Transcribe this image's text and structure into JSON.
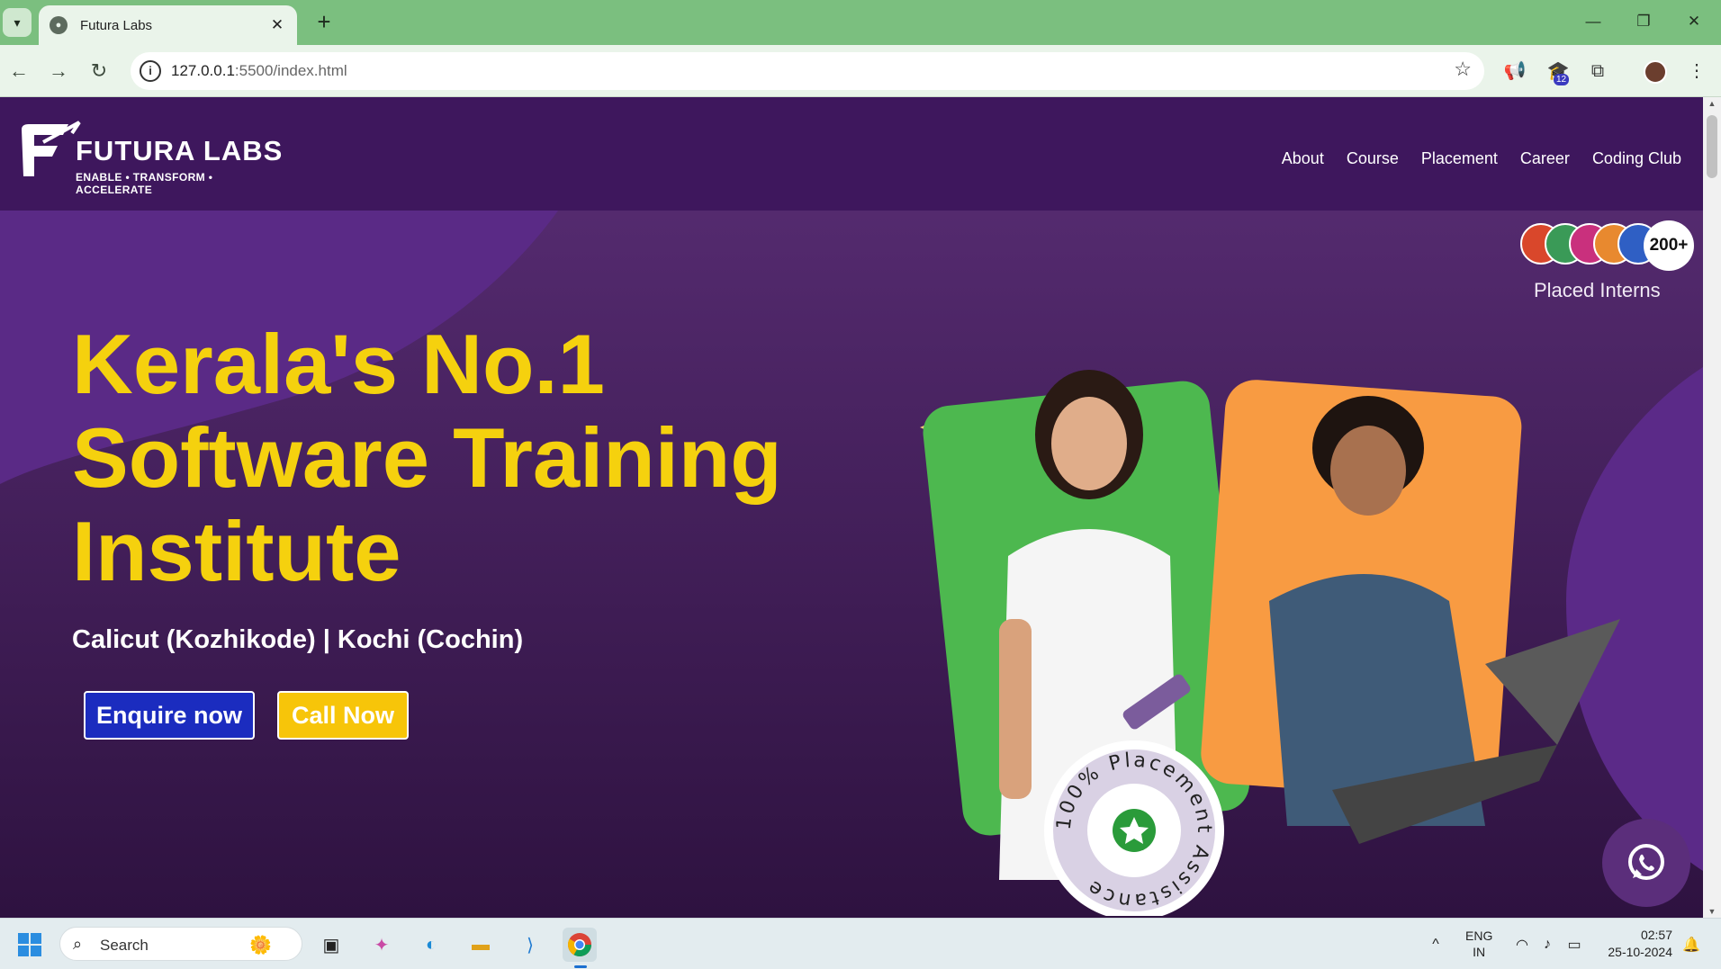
{
  "browser": {
    "tab_title": "Futura Labs",
    "url_host": "127.0.0.1",
    "url_rest": ":5500/index.html",
    "extension_badge": "12"
  },
  "site": {
    "brand": "FUTURA LABS",
    "tagline": "ENABLE • TRANSFORM • ACCELERATE",
    "nav": [
      "About",
      "Course",
      "Placement",
      "Career",
      "Coding Club"
    ],
    "hero": {
      "title_line1": "Kerala's No.1",
      "title_line2": "Software Training",
      "title_line3": "Institute",
      "subtitle": "Calicut (Kozhikode) | Kochi (Cochin)",
      "enquire_label": "Enquire now",
      "call_label": "Call Now"
    },
    "interns": {
      "count": "200+",
      "label": "Placed Interns"
    },
    "badge_text": "100% Placement Assistance",
    "colors": {
      "header_bg": "#3e175d",
      "hero_title": "#f5d10e",
      "enquire_bg": "#1b2cbf",
      "call_bg": "#f7c509",
      "green_card": "#4db84f",
      "orange_card": "#f89b42"
    }
  },
  "taskbar": {
    "search_placeholder": "Search",
    "lang_line1": "ENG",
    "lang_line2": "IN",
    "time": "02:57",
    "date": "25-10-2024"
  }
}
